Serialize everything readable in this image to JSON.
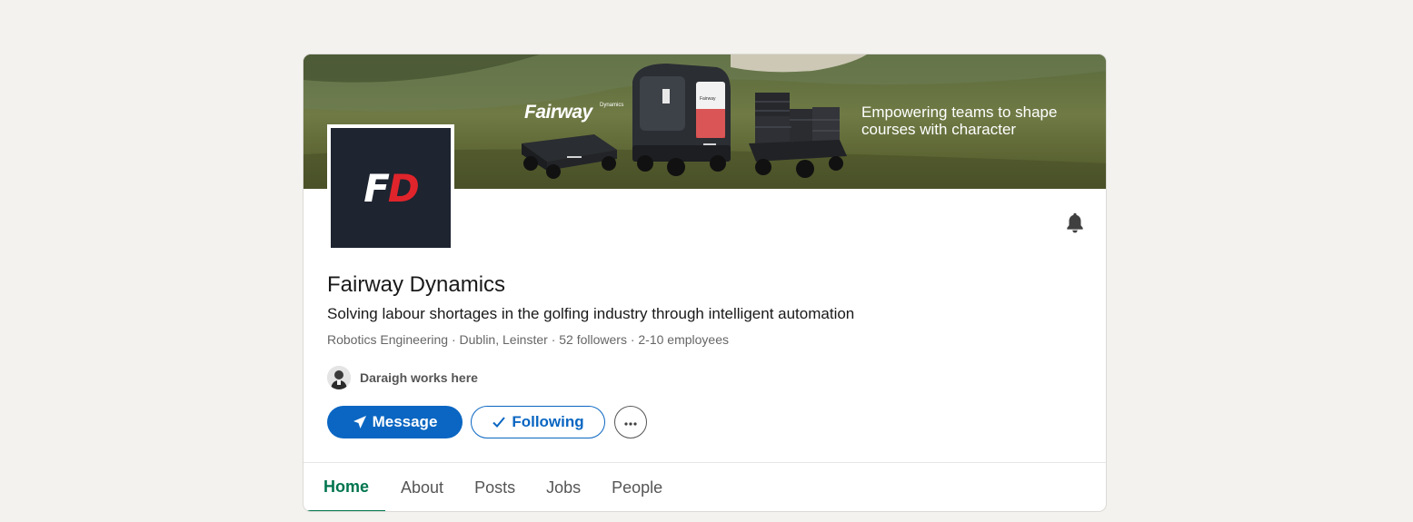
{
  "banner": {
    "brand": "Fairway",
    "brand_sub": "Dynamics",
    "tagline": "Empowering teams to shape courses with character",
    "robot_label": "Fairway"
  },
  "logo": {
    "letter1": "F",
    "letter2": "D"
  },
  "company": {
    "name": "Fairway Dynamics",
    "tagline": "Solving labour shortages in the golfing industry through intelligent automation",
    "meta": "Robotics Engineering · Dublin, Leinster · 52 followers · 2-10 employees",
    "works_here": "Daraigh works here"
  },
  "actions": {
    "message_label": "Message",
    "following_label": "Following",
    "more_icon": "ellipsis-icon"
  },
  "tabs": [
    {
      "label": "Home",
      "active": true
    },
    {
      "label": "About",
      "active": false
    },
    {
      "label": "Posts",
      "active": false
    },
    {
      "label": "Jobs",
      "active": false
    },
    {
      "label": "People",
      "active": false
    }
  ],
  "colors": {
    "primary": "#0a66c2",
    "active_tab": "#01754f",
    "logo_bg": "#1e2430",
    "logo_accent": "#e0242b"
  }
}
